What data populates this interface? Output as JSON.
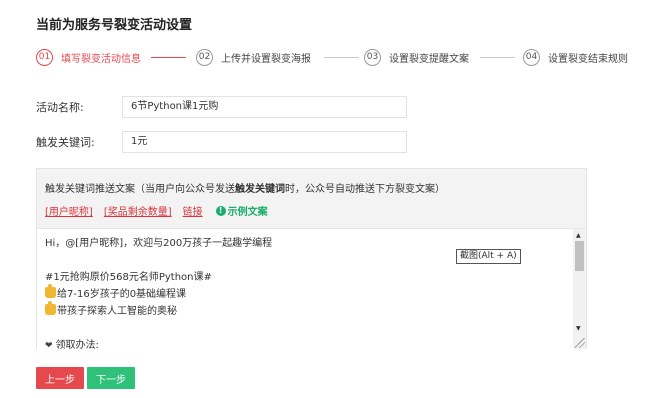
{
  "page_title": "当前为服务号裂变活动设置",
  "steps": [
    {
      "num": "01",
      "label": "填写裂变活动信息",
      "active": true
    },
    {
      "num": "02",
      "label": "上传并设置裂变海报",
      "active": false
    },
    {
      "num": "03",
      "label": "设置裂变提醒文案",
      "active": false
    },
    {
      "num": "04",
      "label": "设置裂变结束规则",
      "active": false
    }
  ],
  "form": {
    "activity_name_label": "活动名称:",
    "activity_name_value": "6节Python课1元购",
    "keyword_label": "触发关键词:",
    "keyword_value": "1元"
  },
  "panel": {
    "desc_prefix": "触发关键词推送文案（当用户向公众号发送",
    "desc_bold": "触发关键词",
    "desc_suffix": "时，公众号自动推送下方裂变文案）",
    "tags": [
      "[用户昵称]",
      "[奖品剩余数量]",
      "链接"
    ],
    "example_label": "示例文案",
    "editor_lines": [
      "Hi，@[用户昵称]，欢迎与200万孩子一起趣学编程",
      "",
      "#1元抢购原价568元名师Python课#",
      "给7-16岁孩子的0基础编程课",
      "带孩子探索人工智能的奥秘",
      "",
      "领取办法:"
    ]
  },
  "screenshot_tip": "截图(Alt + A)",
  "buttons": {
    "prev": "上一步",
    "next": "下一步"
  },
  "colors": {
    "accent_red": "#e5484d",
    "accent_green": "#2fc07a"
  }
}
